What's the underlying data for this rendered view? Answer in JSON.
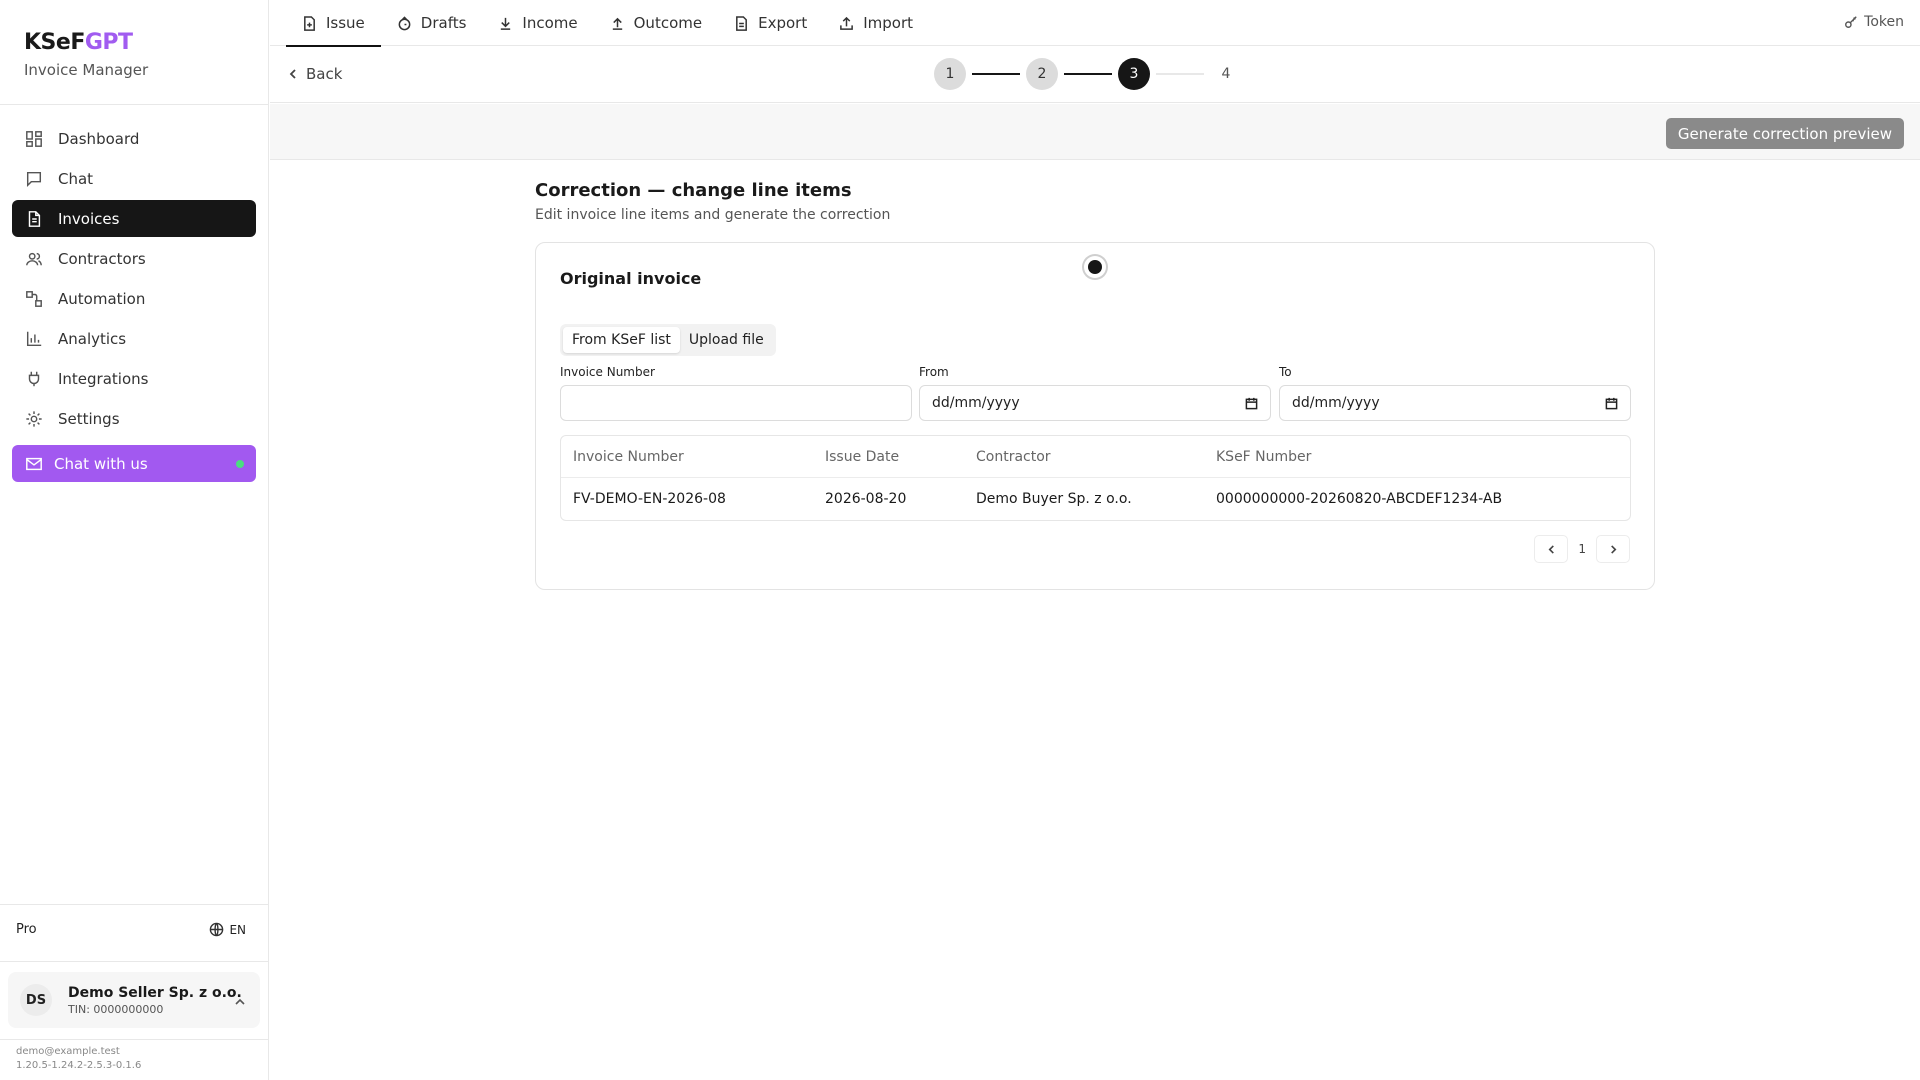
{
  "brand": {
    "name_a": "KSeF",
    "name_b": "GPT",
    "subtitle": "Invoice Manager"
  },
  "sidebar": {
    "items": [
      {
        "label": "Dashboard",
        "icon": "grid-icon"
      },
      {
        "label": "Chat",
        "icon": "chat-icon"
      },
      {
        "label": "Invoices",
        "icon": "document-icon",
        "active": true
      },
      {
        "label": "Contractors",
        "icon": "users-icon"
      },
      {
        "label": "Automation",
        "icon": "workflow-icon"
      },
      {
        "label": "Analytics",
        "icon": "bar-chart-icon"
      },
      {
        "label": "Integrations",
        "icon": "plug-icon"
      },
      {
        "label": "Settings",
        "icon": "gear-icon"
      }
    ],
    "chat_with_us": "Chat with us",
    "plan": "Pro",
    "language": "EN",
    "account": {
      "initials": "DS",
      "name": "Demo Seller Sp. z o.o.",
      "tin": "TIN: 0000000000"
    },
    "footer_email": "demo@example.test",
    "footer_version": "1.20.5-1.24.2-2.5.3-0.1.6"
  },
  "topbar": {
    "tabs": [
      {
        "label": "Issue",
        "icon": "file-plus-icon",
        "active": true
      },
      {
        "label": "Drafts",
        "icon": "drafts-icon"
      },
      {
        "label": "Income",
        "icon": "download-icon"
      },
      {
        "label": "Outcome",
        "icon": "upload-icon"
      },
      {
        "label": "Export",
        "icon": "file-export-icon"
      },
      {
        "label": "Import",
        "icon": "import-icon"
      }
    ],
    "token_label": "Token"
  },
  "subbar": {
    "back_label": "Back",
    "steps": [
      "1",
      "2",
      "3",
      "4"
    ],
    "current_step": 3
  },
  "actionbar": {
    "generate_label": "Generate correction preview"
  },
  "main": {
    "title": "Correction — change line items",
    "subtitle": "Edit invoice line items and generate the correction",
    "card": {
      "title": "Original invoice",
      "segments": [
        "From KSeF list",
        "Upload file"
      ],
      "active_segment": 0,
      "fields": {
        "invoice_number": {
          "label": "Invoice Number",
          "value": ""
        },
        "from": {
          "label": "From",
          "value": "dd/mm/yyyy"
        },
        "to": {
          "label": "To",
          "value": "dd/mm/yyyy"
        }
      },
      "table": {
        "columns": [
          "Invoice Number",
          "Issue Date",
          "Contractor",
          "KSeF Number"
        ],
        "rows": [
          [
            "FV-DEMO-EN-2026-08",
            "2026-08-20",
            "Demo Buyer Sp. z o.o.",
            "0000000000-20260820-ABCDEF1234-AB"
          ]
        ]
      },
      "pagination": {
        "page": "1"
      }
    }
  }
}
